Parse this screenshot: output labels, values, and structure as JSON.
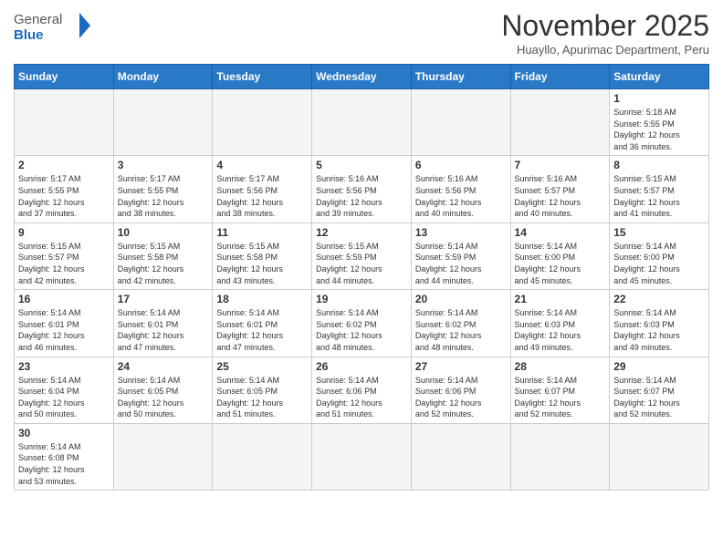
{
  "header": {
    "logo_general": "General",
    "logo_blue": "Blue",
    "month_title": "November 2025",
    "subtitle": "Huayllo, Apurimac Department, Peru"
  },
  "weekdays": [
    "Sunday",
    "Monday",
    "Tuesday",
    "Wednesday",
    "Thursday",
    "Friday",
    "Saturday"
  ],
  "weeks": [
    [
      {
        "day": "",
        "info": ""
      },
      {
        "day": "",
        "info": ""
      },
      {
        "day": "",
        "info": ""
      },
      {
        "day": "",
        "info": ""
      },
      {
        "day": "",
        "info": ""
      },
      {
        "day": "",
        "info": ""
      },
      {
        "day": "1",
        "info": "Sunrise: 5:18 AM\nSunset: 5:55 PM\nDaylight: 12 hours\nand 36 minutes."
      }
    ],
    [
      {
        "day": "2",
        "info": "Sunrise: 5:17 AM\nSunset: 5:55 PM\nDaylight: 12 hours\nand 37 minutes."
      },
      {
        "day": "3",
        "info": "Sunrise: 5:17 AM\nSunset: 5:55 PM\nDaylight: 12 hours\nand 38 minutes."
      },
      {
        "day": "4",
        "info": "Sunrise: 5:17 AM\nSunset: 5:56 PM\nDaylight: 12 hours\nand 38 minutes."
      },
      {
        "day": "5",
        "info": "Sunrise: 5:16 AM\nSunset: 5:56 PM\nDaylight: 12 hours\nand 39 minutes."
      },
      {
        "day": "6",
        "info": "Sunrise: 5:16 AM\nSunset: 5:56 PM\nDaylight: 12 hours\nand 40 minutes."
      },
      {
        "day": "7",
        "info": "Sunrise: 5:16 AM\nSunset: 5:57 PM\nDaylight: 12 hours\nand 40 minutes."
      },
      {
        "day": "8",
        "info": "Sunrise: 5:15 AM\nSunset: 5:57 PM\nDaylight: 12 hours\nand 41 minutes."
      }
    ],
    [
      {
        "day": "9",
        "info": "Sunrise: 5:15 AM\nSunset: 5:57 PM\nDaylight: 12 hours\nand 42 minutes."
      },
      {
        "day": "10",
        "info": "Sunrise: 5:15 AM\nSunset: 5:58 PM\nDaylight: 12 hours\nand 42 minutes."
      },
      {
        "day": "11",
        "info": "Sunrise: 5:15 AM\nSunset: 5:58 PM\nDaylight: 12 hours\nand 43 minutes."
      },
      {
        "day": "12",
        "info": "Sunrise: 5:15 AM\nSunset: 5:59 PM\nDaylight: 12 hours\nand 44 minutes."
      },
      {
        "day": "13",
        "info": "Sunrise: 5:14 AM\nSunset: 5:59 PM\nDaylight: 12 hours\nand 44 minutes."
      },
      {
        "day": "14",
        "info": "Sunrise: 5:14 AM\nSunset: 6:00 PM\nDaylight: 12 hours\nand 45 minutes."
      },
      {
        "day": "15",
        "info": "Sunrise: 5:14 AM\nSunset: 6:00 PM\nDaylight: 12 hours\nand 45 minutes."
      }
    ],
    [
      {
        "day": "16",
        "info": "Sunrise: 5:14 AM\nSunset: 6:01 PM\nDaylight: 12 hours\nand 46 minutes."
      },
      {
        "day": "17",
        "info": "Sunrise: 5:14 AM\nSunset: 6:01 PM\nDaylight: 12 hours\nand 47 minutes."
      },
      {
        "day": "18",
        "info": "Sunrise: 5:14 AM\nSunset: 6:01 PM\nDaylight: 12 hours\nand 47 minutes."
      },
      {
        "day": "19",
        "info": "Sunrise: 5:14 AM\nSunset: 6:02 PM\nDaylight: 12 hours\nand 48 minutes."
      },
      {
        "day": "20",
        "info": "Sunrise: 5:14 AM\nSunset: 6:02 PM\nDaylight: 12 hours\nand 48 minutes."
      },
      {
        "day": "21",
        "info": "Sunrise: 5:14 AM\nSunset: 6:03 PM\nDaylight: 12 hours\nand 49 minutes."
      },
      {
        "day": "22",
        "info": "Sunrise: 5:14 AM\nSunset: 6:03 PM\nDaylight: 12 hours\nand 49 minutes."
      }
    ],
    [
      {
        "day": "23",
        "info": "Sunrise: 5:14 AM\nSunset: 6:04 PM\nDaylight: 12 hours\nand 50 minutes."
      },
      {
        "day": "24",
        "info": "Sunrise: 5:14 AM\nSunset: 6:05 PM\nDaylight: 12 hours\nand 50 minutes."
      },
      {
        "day": "25",
        "info": "Sunrise: 5:14 AM\nSunset: 6:05 PM\nDaylight: 12 hours\nand 51 minutes."
      },
      {
        "day": "26",
        "info": "Sunrise: 5:14 AM\nSunset: 6:06 PM\nDaylight: 12 hours\nand 51 minutes."
      },
      {
        "day": "27",
        "info": "Sunrise: 5:14 AM\nSunset: 6:06 PM\nDaylight: 12 hours\nand 52 minutes."
      },
      {
        "day": "28",
        "info": "Sunrise: 5:14 AM\nSunset: 6:07 PM\nDaylight: 12 hours\nand 52 minutes."
      },
      {
        "day": "29",
        "info": "Sunrise: 5:14 AM\nSunset: 6:07 PM\nDaylight: 12 hours\nand 52 minutes."
      }
    ],
    [
      {
        "day": "30",
        "info": "Sunrise: 5:14 AM\nSunset: 6:08 PM\nDaylight: 12 hours\nand 53 minutes."
      },
      {
        "day": "",
        "info": ""
      },
      {
        "day": "",
        "info": ""
      },
      {
        "day": "",
        "info": ""
      },
      {
        "day": "",
        "info": ""
      },
      {
        "day": "",
        "info": ""
      },
      {
        "day": "",
        "info": ""
      }
    ]
  ]
}
